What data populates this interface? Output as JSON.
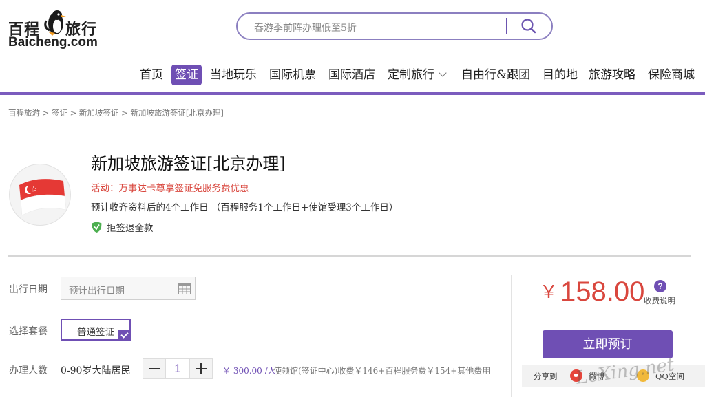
{
  "logo": {
    "cn_left": "百程",
    "cn_right": "旅行",
    "en": "Baicheng.com"
  },
  "search": {
    "placeholder": "春游季前阵办理低至5折"
  },
  "nav": {
    "items": [
      {
        "label": "首页"
      },
      {
        "label": "签证",
        "active": true
      },
      {
        "label": "当地玩乐"
      },
      {
        "label": "国际机票"
      },
      {
        "label": "国际酒店"
      },
      {
        "label": "定制旅行",
        "has_dropdown": true
      },
      {
        "label": "自由行&跟团"
      },
      {
        "label": "目的地"
      },
      {
        "label": "旅游攻略"
      },
      {
        "label": "保险商城"
      }
    ]
  },
  "breadcrumb": [
    "百程旅游",
    "签证",
    "新加坡签证",
    "新加坡旅游签证[北京办理]"
  ],
  "breadcrumb_separator": " > ",
  "product": {
    "title": "新加坡旅游签证[北京办理]",
    "activity": "活动：万事达卡尊享签证免服务费优惠",
    "timeline": "预计收齐资料后的4个工作日 （百程服务1个工作日+使馆受理3个工作日）",
    "refund": "拒签退全款",
    "flag_icon": "singapore-flag"
  },
  "form": {
    "date_label": "出行日期",
    "date_placeholder": "预计出行日期",
    "package_label": "选择套餐",
    "package_selected": "普通签证",
    "people_label": "办理人数",
    "people_type": "0-90岁大陆居民",
    "quantity": "1",
    "unit_price": "￥ 300.00 /人",
    "fee_detail": "使领馆(签证中心)收费￥146+百程服务费￥154+其他费用"
  },
  "price_box": {
    "currency": "￥",
    "amount": "158.00",
    "help_label": "收费说明",
    "book_label": "立即预订",
    "share_label": "分享到",
    "weibo_label": "微博",
    "qq_label": "QQ空间"
  },
  "watermark": "LeXing.net",
  "colors": {
    "brand_purple": "#6f4fb4",
    "price_red": "#d9473e",
    "search_border": "#8b7fc0"
  }
}
